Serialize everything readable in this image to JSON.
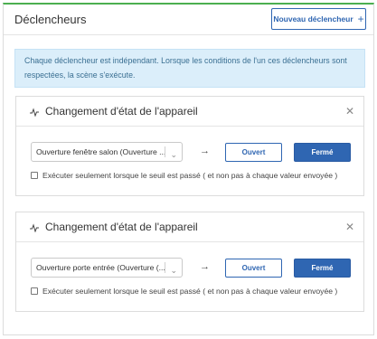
{
  "panel": {
    "title": "Déclencheurs",
    "new_trigger_label": "Nouveau déclencheur",
    "new_trigger_icon": "plus-icon"
  },
  "info": {
    "line1": "Chaque déclencheur est indépendant. Lorsque les conditions de l'un ces déclencheurs sont",
    "line2": "respectées, la scène s'exécute."
  },
  "triggers": [
    {
      "title": "Changement d'état de l'appareil",
      "device": "Ouverture fenêtre salon (Ouverture ...",
      "open_label": "Ouvert",
      "closed_label": "Fermé",
      "selected_state": "Fermé",
      "threshold_label": "Exécuter seulement lorsque le seuil est passé ( et non pas à chaque valeur envoyée )",
      "threshold_checked": false
    },
    {
      "title": "Changement d'état de l'appareil",
      "device": "Ouverture porte entrée (Ouverture (...",
      "open_label": "Ouvert",
      "closed_label": "Fermé",
      "selected_state": "Fermé",
      "threshold_label": "Exécuter seulement lorsque le seuil est passé ( et non pas à chaque valeur envoyée )",
      "threshold_checked": false
    }
  ],
  "colors": {
    "accent": "#2f66b2",
    "header_border": "#4caf50",
    "info_bg": "#dbeefa",
    "info_text": "#3a6f92"
  }
}
